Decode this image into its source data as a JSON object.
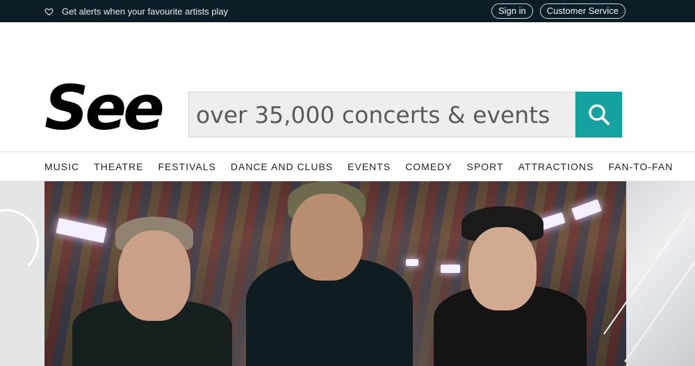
{
  "topbar": {
    "alert_text": "Get alerts when your favourite artists play",
    "alert_icon": "heart-icon",
    "sign_in": "Sign in",
    "customer_service": "Customer Service"
  },
  "header": {
    "logo": "See",
    "search_placeholder": "over 35,000 concerts & events",
    "search_icon": "search-icon",
    "accent_color": "#17a2a2"
  },
  "nav": {
    "items": [
      "MUSIC",
      "THEATRE",
      "FESTIVALS",
      "DANCE AND CLUBS",
      "EVENTS",
      "COMEDY",
      "SPORT",
      "ATTRACTIONS",
      "FAN-TO-FAN"
    ]
  }
}
